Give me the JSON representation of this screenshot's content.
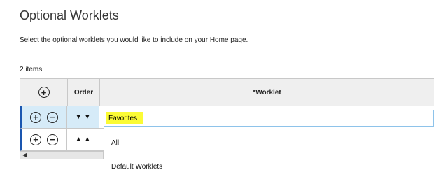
{
  "page": {
    "title": "Optional Worklets",
    "subtitle": "Select the optional worklets you would like to include on your Home page.",
    "item_count": "2 items"
  },
  "table": {
    "headers": {
      "add": "+",
      "order": "Order",
      "worklet": "*Worklet"
    },
    "rows": [
      {
        "add": "+",
        "remove": "−",
        "order_icons": "▼ ▼",
        "worklet_value": "Favorites"
      },
      {
        "add": "+",
        "remove": "−",
        "order_icons": "▲ ▲",
        "worklet_value": ""
      }
    ]
  },
  "dropdown": {
    "options": [
      "All",
      "Default Worklets"
    ]
  },
  "scrollbar": {
    "left_arrow": "◀"
  },
  "colors": {
    "highlight": "#fbfb35",
    "selected_row": "#d6ebf8",
    "row_accent": "#1a56b0",
    "input_border": "#8ec3ea"
  }
}
